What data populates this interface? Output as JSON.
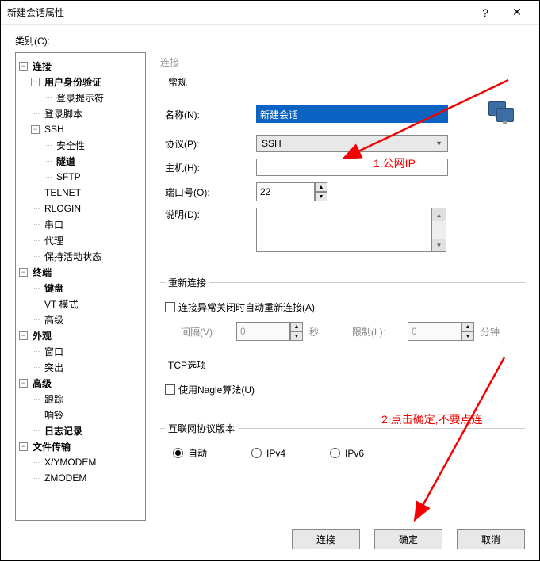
{
  "titlebar": {
    "title": "新建会话属性",
    "help": "?",
    "close": "✕"
  },
  "category_label": "类别(C):",
  "tree": [
    {
      "level": 0,
      "expand": "-",
      "label": "连接",
      "bold": true
    },
    {
      "level": 1,
      "expand": "-",
      "label": "用户身份验证",
      "bold": true
    },
    {
      "level": 2,
      "expand": null,
      "label": "登录提示符",
      "bold": false
    },
    {
      "level": 1,
      "expand": null,
      "label": "登录脚本",
      "bold": false
    },
    {
      "level": 1,
      "expand": "-",
      "label": "SSH",
      "bold": false
    },
    {
      "level": 2,
      "expand": null,
      "label": "安全性",
      "bold": false
    },
    {
      "level": 2,
      "expand": null,
      "label": "隧道",
      "bold": true
    },
    {
      "level": 2,
      "expand": null,
      "label": "SFTP",
      "bold": false
    },
    {
      "level": 1,
      "expand": null,
      "label": "TELNET",
      "bold": false
    },
    {
      "level": 1,
      "expand": null,
      "label": "RLOGIN",
      "bold": false
    },
    {
      "level": 1,
      "expand": null,
      "label": "串口",
      "bold": false
    },
    {
      "level": 1,
      "expand": null,
      "label": "代理",
      "bold": false
    },
    {
      "level": 1,
      "expand": null,
      "label": "保持活动状态",
      "bold": false
    },
    {
      "level": 0,
      "expand": "-",
      "label": "终端",
      "bold": true
    },
    {
      "level": 1,
      "expand": null,
      "label": "键盘",
      "bold": true
    },
    {
      "level": 1,
      "expand": null,
      "label": "VT 模式",
      "bold": false
    },
    {
      "level": 1,
      "expand": null,
      "label": "高级",
      "bold": false
    },
    {
      "level": 0,
      "expand": "-",
      "label": "外观",
      "bold": true
    },
    {
      "level": 1,
      "expand": null,
      "label": "窗口",
      "bold": false
    },
    {
      "level": 1,
      "expand": null,
      "label": "突出",
      "bold": false
    },
    {
      "level": 0,
      "expand": "-",
      "label": "高级",
      "bold": true
    },
    {
      "level": 1,
      "expand": null,
      "label": "跟踪",
      "bold": false
    },
    {
      "level": 1,
      "expand": null,
      "label": "响铃",
      "bold": false
    },
    {
      "level": 1,
      "expand": null,
      "label": "日志记录",
      "bold": true
    },
    {
      "level": 0,
      "expand": "-",
      "label": "文件传输",
      "bold": true
    },
    {
      "level": 1,
      "expand": null,
      "label": "X/YMODEM",
      "bold": false
    },
    {
      "level": 1,
      "expand": null,
      "label": "ZMODEM",
      "bold": false
    }
  ],
  "panel_header": "连接",
  "general": {
    "legend": "常规",
    "name_label": "名称(N):",
    "name_value": "新建会话",
    "protocol_label": "协议(P):",
    "protocol_value": "SSH",
    "host_label": "主机(H):",
    "host_value": "",
    "port_label": "端口号(O):",
    "port_value": "22",
    "desc_label": "说明(D):",
    "desc_value": ""
  },
  "reconnect": {
    "legend": "重新连接",
    "checkbox_label": "连接异常关闭时自动重新连接(A)",
    "checked": false,
    "interval_label": "间隔(V):",
    "interval_value": "0",
    "interval_unit": "秒",
    "limit_label": "限制(L):",
    "limit_value": "0",
    "limit_unit": "分钟"
  },
  "tcp": {
    "legend": "TCP选项",
    "nagle_label": "使用Nagle算法(U)",
    "nagle_checked": false
  },
  "ipver": {
    "legend": "互联网协议版本",
    "options": [
      "自动",
      "IPv4",
      "IPv6"
    ],
    "selected": 0
  },
  "footer": {
    "connect": "连接",
    "ok": "确定",
    "cancel": "取消"
  },
  "annotations": {
    "a1": "1.公网IP",
    "a2": "2.点击确定,不要点连"
  }
}
